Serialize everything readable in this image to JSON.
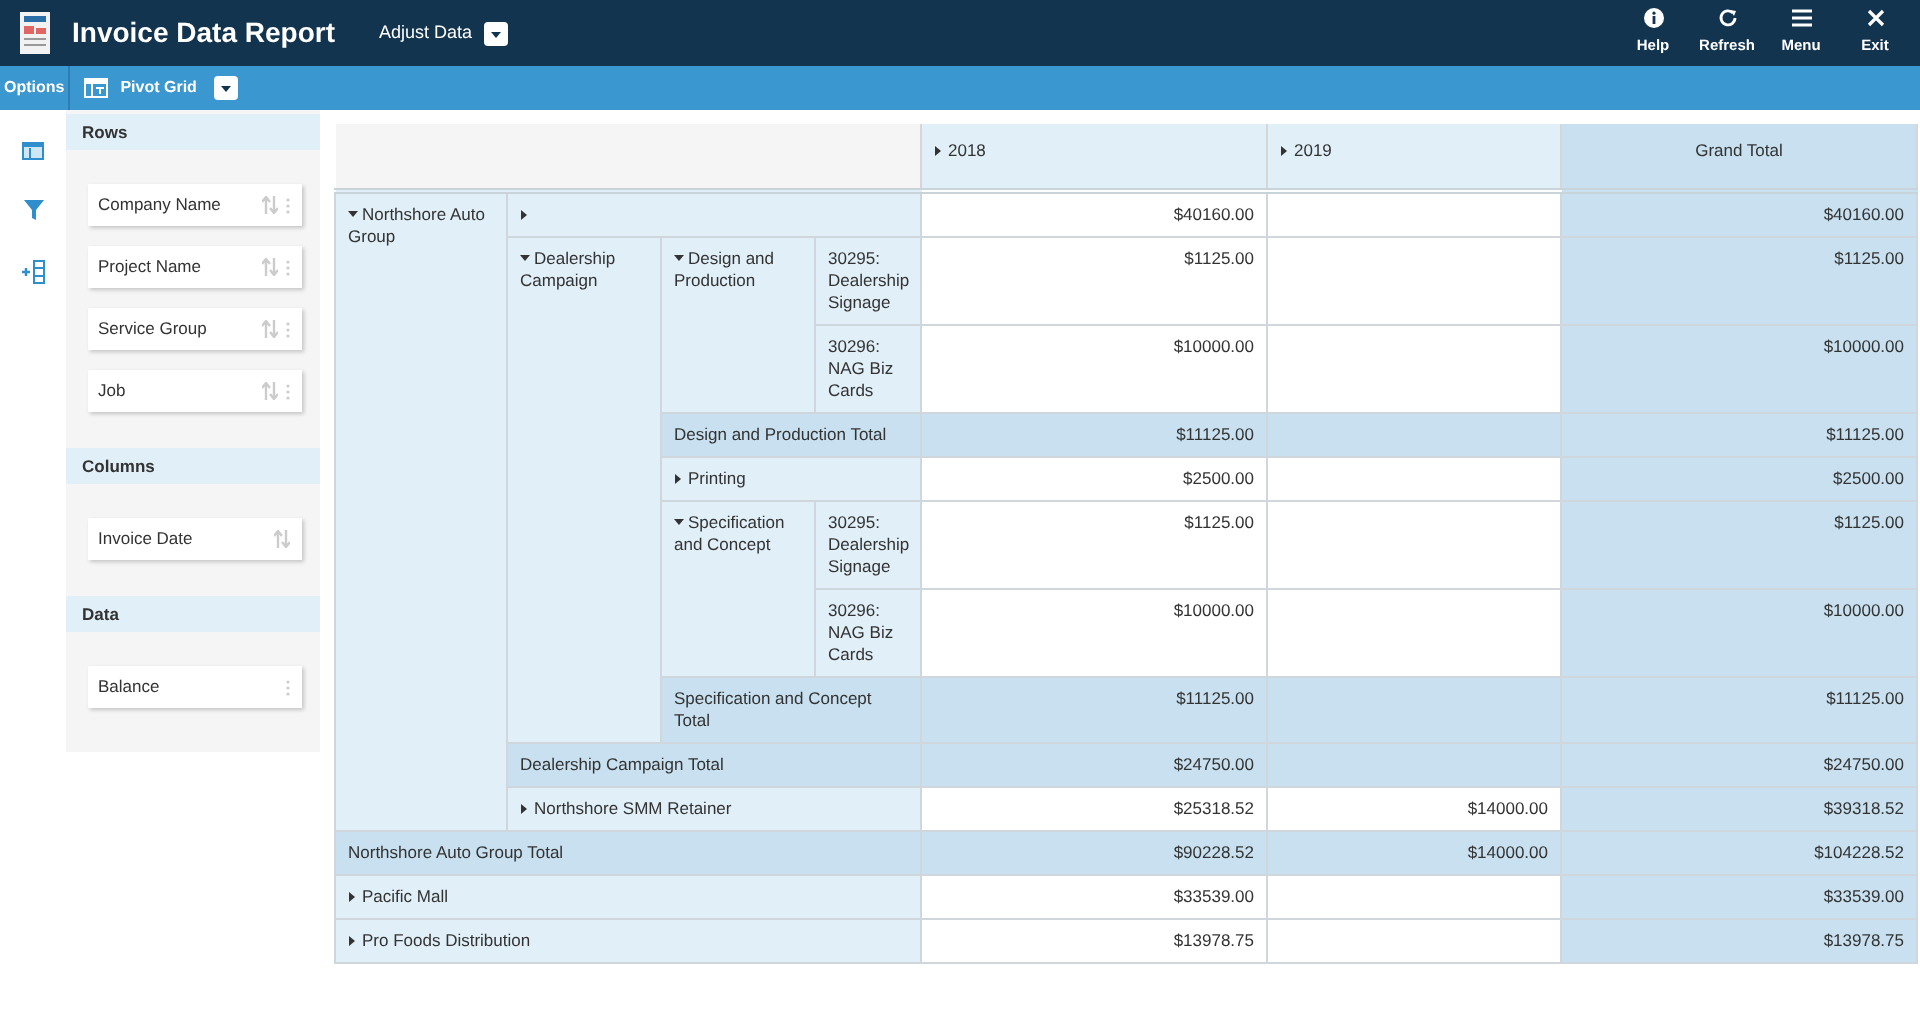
{
  "app_bar": {
    "title": "Invoice Data Report",
    "menu": "Adjust Data",
    "actions": [
      {
        "kind": "help",
        "label": "Help"
      },
      {
        "kind": "refresh",
        "label": "Refresh"
      },
      {
        "kind": "menu",
        "label": "Menu"
      },
      {
        "kind": "exit",
        "label": "Exit"
      }
    ]
  },
  "toolbar": {
    "options": "Options",
    "view": "Pivot Grid"
  },
  "field_panel": {
    "sections": [
      {
        "title": "Rows",
        "fields": [
          {
            "label": "Company Name",
            "sortable": true,
            "menu": true
          },
          {
            "label": "Project Name",
            "sortable": true,
            "menu": true
          },
          {
            "label": "Service Group",
            "sortable": true,
            "menu": true
          },
          {
            "label": "Job",
            "sortable": true,
            "menu": true
          }
        ]
      },
      {
        "title": "Columns",
        "fields": [
          {
            "label": "Invoice Date",
            "sortable": true,
            "menu": false
          }
        ]
      },
      {
        "title": "Data",
        "fields": [
          {
            "label": "Balance",
            "sortable": false,
            "menu": true
          }
        ]
      }
    ]
  },
  "pivot": {
    "columns": [
      {
        "label": "2018",
        "expanded": false
      },
      {
        "label": "2019",
        "expanded": false
      },
      {
        "label": "Grand Total"
      }
    ],
    "rows": [
      {
        "headers": [
          {
            "text": "Northshore Auto Group",
            "expanded": true,
            "rowspan": 10
          },
          {
            "expanded": false,
            "colspan": 3
          }
        ],
        "values": {
          "column_1": "$40160.00",
          "column_3": "$40160.00"
        }
      },
      {
        "headers": [
          {
            "text": "Dealership Campaign",
            "expanded": true,
            "rowspan": 7
          },
          {
            "text": "Design and Production",
            "expanded": true,
            "rowspan": 2
          },
          {
            "text": "30295: Dealership Signage"
          }
        ],
        "values": {
          "column_1": "$1125.00",
          "column_3": "$1125.00"
        }
      },
      {
        "headers": [
          {
            "text": "30296: NAG Biz Cards"
          }
        ],
        "values": {
          "column_1": "$10000.00",
          "column_3": "$10000.00"
        }
      },
      {
        "total": true,
        "headers": [
          {
            "text": "Design and Production Total",
            "colspan": 2
          }
        ],
        "values": {
          "column_1": "$11125.00",
          "column_3": "$11125.00"
        }
      },
      {
        "headers": [
          {
            "text": "Printing",
            "expanded": false,
            "colspan": 2
          }
        ],
        "values": {
          "column_1": "$2500.00",
          "column_3": "$2500.00"
        }
      },
      {
        "headers": [
          {
            "text": "Specification and Concept",
            "expanded": true,
            "rowspan": 2
          },
          {
            "text": "30295: Dealership Signage"
          }
        ],
        "values": {
          "column_1": "$1125.00",
          "column_3": "$1125.00"
        }
      },
      {
        "headers": [
          {
            "text": "30296: NAG Biz Cards"
          }
        ],
        "values": {
          "column_1": "$10000.00",
          "column_3": "$10000.00"
        }
      },
      {
        "total": true,
        "headers": [
          {
            "text": "Specification and Concept Total",
            "colspan": 2
          }
        ],
        "values": {
          "column_1": "$11125.00",
          "column_3": "$11125.00"
        }
      },
      {
        "total": true,
        "headers": [
          {
            "text": "Dealership Campaign Total",
            "colspan": 3
          }
        ],
        "values": {
          "column_1": "$24750.00",
          "column_3": "$24750.00"
        }
      },
      {
        "headers": [
          {
            "text": "Northshore SMM Retainer",
            "expanded": false,
            "colspan": 3
          }
        ],
        "values": {
          "column_1": "$25318.52",
          "column_2": "$14000.00",
          "column_3": "$39318.52"
        }
      },
      {
        "total": true,
        "headers": [
          {
            "text": "Northshore Auto Group Total",
            "colspan": 4
          }
        ],
        "values": {
          "column_1": "$90228.52",
          "column_2": "$14000.00",
          "column_3": "$104228.52"
        }
      },
      {
        "headers": [
          {
            "text": "Pacific Mall",
            "expanded": false,
            "colspan": 4
          }
        ],
        "values": {
          "column_1": "$33539.00",
          "column_3": "$33539.00"
        }
      },
      {
        "headers": [
          {
            "text": "Pro Foods Distribution",
            "expanded": false,
            "colspan": 4
          }
        ],
        "values": {
          "column_1": "$13978.75",
          "column_3": "$13978.75"
        }
      }
    ]
  }
}
